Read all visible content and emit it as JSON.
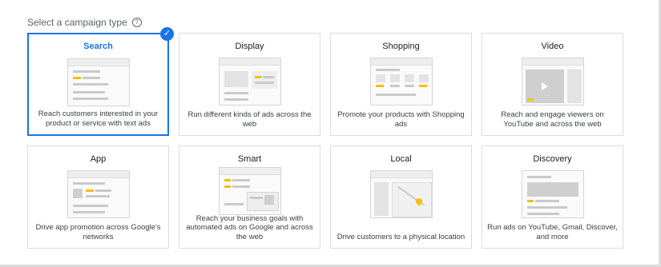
{
  "header": {
    "label": "Select a campaign type",
    "help_icon": "help-circle-icon"
  },
  "colors": {
    "accent": "#1a73e8",
    "highlight": "#fbbc04",
    "border": "#dadce0"
  },
  "cards": [
    {
      "title": "Search",
      "desc": "Reach customers interested in your product or service with text ads",
      "selected": true,
      "icon": "search-illustration"
    },
    {
      "title": "Display",
      "desc": "Run different kinds of ads across the web",
      "selected": false,
      "icon": "display-illustration"
    },
    {
      "title": "Shopping",
      "desc": "Promote your products with Shopping ads",
      "selected": false,
      "icon": "shopping-illustration"
    },
    {
      "title": "Video",
      "desc": "Reach and engage viewers on YouTube and across the web",
      "selected": false,
      "icon": "video-illustration"
    },
    {
      "title": "App",
      "desc": "Drive app promotion across Google's networks",
      "selected": false,
      "icon": "app-illustration"
    },
    {
      "title": "Smart",
      "desc": "Reach your business goals with automated ads on Google and across the web",
      "selected": false,
      "icon": "smart-illustration"
    },
    {
      "title": "Local",
      "desc": "Drive customers to a physical location",
      "selected": false,
      "icon": "local-illustration"
    },
    {
      "title": "Discovery",
      "desc": "Run ads on YouTube, Gmail, Discover, and more",
      "selected": false,
      "icon": "discovery-illustration"
    }
  ]
}
